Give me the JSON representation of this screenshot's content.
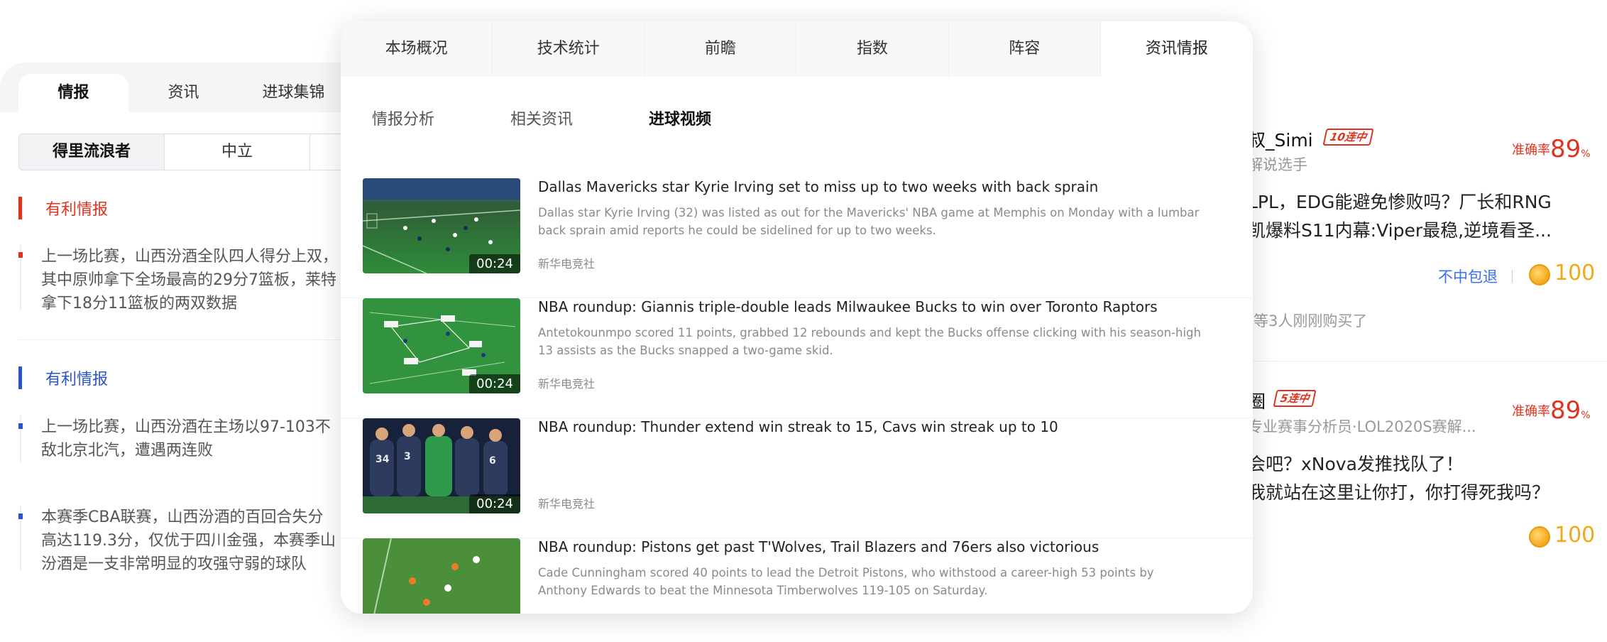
{
  "left": {
    "tabs": [
      "情报",
      "资讯",
      "进球集锦"
    ],
    "segments": [
      "得里流浪者",
      "中立"
    ],
    "sections": [
      {
        "title": "有利情报",
        "color": "#e0321e",
        "items": [
          [
            "上一场比赛，山西汾酒全队四人得分上双，",
            "其中原帅拿下全场最高的29分7篮板，莱特",
            "拿下18分11篮板的两双数据"
          ]
        ]
      },
      {
        "title": "有利情报",
        "color": "#2a55c9",
        "items": [
          [
            "上一场比赛，山西汾酒在主场以97-103不",
            "敌北京北汽，遭遇两连败"
          ],
          [
            "本赛季CBA联赛，山西汾酒的百回合失分",
            "高达119.3分，仅优于四川金强，本赛季山",
            "汾酒是一支非常明显的攻强守弱的球队"
          ]
        ]
      }
    ]
  },
  "right": {
    "cards": [
      {
        "name": "叔_Simi",
        "badge": "10连中",
        "subtitle": "解说选手",
        "accuracy_label": "准确率",
        "accuracy": "89",
        "pct": "%",
        "title_lines": [
          "LPL，EDG能避免惨败吗？厂长和RNG",
          "凯爆料S11内幕:Viper最稳,逆境看圣..."
        ],
        "refund": "不中包退",
        "price": "100",
        "buyers": "等3人刚刚购买了"
      },
      {
        "name": "圈",
        "badge": "5连中",
        "subtitle": "专业赛事分析员·LOL2020S赛解...",
        "accuracy_label": "准确率",
        "accuracy": "89",
        "pct": "%",
        "title_lines": [
          "会吧？xNova发推找队了！",
          "我就站在这里让你打，你打得死我吗？"
        ],
        "price": "100"
      }
    ]
  },
  "modal": {
    "tabs": [
      "本场概况",
      "技术统计",
      "前瞻",
      "指数",
      "阵容",
      "资讯情报"
    ],
    "active_tab": "资讯情报",
    "subtabs": [
      "情报分析",
      "相关资讯",
      "进球视频"
    ],
    "active_subtab": "进球视频",
    "news": [
      {
        "title": "Dallas Mavericks star Kyrie Irving set to miss up to two weeks with back sprain",
        "desc": "Dallas star Kyrie Irving (32) was listed as out for the Mavericks' NBA game at Memphis on Monday with a lumbar back sprain amid reports he could be sidelined for up to two weeks.",
        "source": "新华电竞社",
        "duration": "00:24"
      },
      {
        "title": "NBA roundup: Giannis triple-double leads Milwaukee Bucks to win over Toronto Raptors",
        "desc": "Antetokounmpo scored 11 points, grabbed 12 rebounds and kept the Bucks offense clicking with his season-high 13 assists as the Bucks snapped a two-game skid.",
        "source": "新华电竞社",
        "duration": "00:24"
      },
      {
        "title": "NBA roundup: Thunder extend win streak to 15, Cavs win streak up to 10",
        "desc": "",
        "source": "新华电竞社",
        "duration": "00:24"
      },
      {
        "title": "NBA roundup: Pistons get past T'Wolves, Trail Blazers and 76ers also victorious",
        "desc": "Cade Cunningham scored 40 points to lead the Detroit Pistons, who withstood a career-high 53 points by Anthony Edwards to beat the Minnesota Timberwolves 119-105 on Saturday.",
        "source": "",
        "duration": ""
      }
    ]
  }
}
